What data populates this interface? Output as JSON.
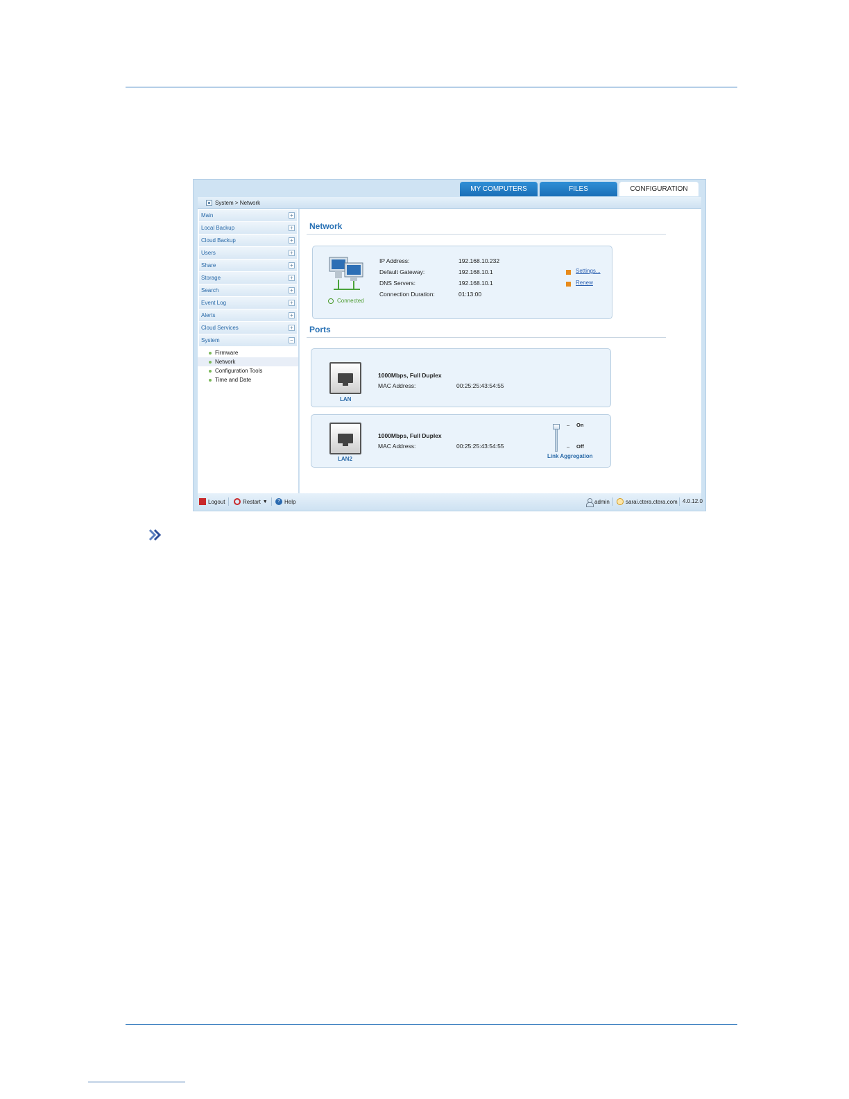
{
  "tabs": [
    {
      "label": "MY COMPUTERS"
    },
    {
      "label": "FILES"
    },
    {
      "label": "CONFIGURATION"
    }
  ],
  "breadcrumb": "System > Network",
  "sidebar": {
    "items": [
      {
        "label": "Main"
      },
      {
        "label": "Local Backup"
      },
      {
        "label": "Cloud Backup"
      },
      {
        "label": "Users"
      },
      {
        "label": "Share"
      },
      {
        "label": "Storage"
      },
      {
        "label": "Search"
      },
      {
        "label": "Event Log"
      },
      {
        "label": "Alerts"
      },
      {
        "label": "Cloud Services"
      },
      {
        "label": "System"
      }
    ],
    "expand_symbol": "+",
    "collapse_symbol": "−",
    "system_subitems": [
      {
        "label": "Firmware"
      },
      {
        "label": "Network"
      },
      {
        "label": "Configuration Tools"
      },
      {
        "label": "Time and Date"
      }
    ]
  },
  "network": {
    "title": "Network",
    "status": "Connected",
    "ip_label": "IP Address:",
    "ip_value": "192.168.10.232",
    "gateway_label": "Default Gateway:",
    "gateway_value": "192.168.10.1",
    "dns_label": "DNS Servers:",
    "dns_value": "192.168.10.1",
    "duration_label": "Connection Duration:",
    "duration_value": "01:13:00",
    "settings_link": "Settings...",
    "renew_link": "Renew"
  },
  "ports": {
    "title": "Ports",
    "lan1": {
      "name": "LAN",
      "speed": "1000Mbps, Full Duplex",
      "mac_label": "MAC Address:",
      "mac_value": "00:25:25:43:54:55"
    },
    "lan2": {
      "name": "LAN2",
      "speed": "1000Mbps, Full Duplex",
      "mac_label": "MAC Address:",
      "mac_value": "00:25:25:43:54:55"
    },
    "link_aggregation": {
      "label": "Link Aggregation",
      "on_label": "On",
      "off_label": "Off",
      "state": "On"
    }
  },
  "statusbar": {
    "logout": "Logout",
    "restart": "Restart",
    "help": "Help",
    "user": "admin",
    "host": "sarai.ctera.ctera.com",
    "version": "4.0.12.0"
  }
}
